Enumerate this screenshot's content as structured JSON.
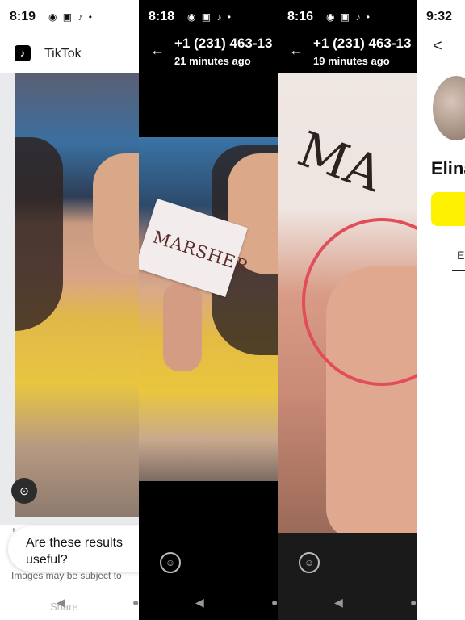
{
  "panel1": {
    "status_time": "8:19",
    "status_icons": "◉ ▣ ♪ •",
    "app_name": "TikTok",
    "app_logo": "♪",
    "lens_icon": "⊙",
    "feedback_question": "Are these results useful?",
    "disclaimer": "Images may be subject to",
    "share_label": "Share",
    "nav_back": "◀",
    "nav_home": "●"
  },
  "panel2": {
    "status_time": "8:18",
    "status_icons": "◉ ▣ ♪ •",
    "contact": "+1 (231) 463-13",
    "subtitle": "21 minutes ago",
    "sign_text": "MARSHER",
    "back_arrow": "←",
    "emoji_icon": "☺",
    "nav_back": "◀",
    "nav_home": "●"
  },
  "panel3": {
    "status_time": "8:16",
    "status_icons": "◉ ▣ ♪ •",
    "contact": "+1 (231) 463-13",
    "subtitle": "19 minutes ago",
    "sign_text": "MA",
    "back_arrow": "←",
    "emoji_icon": "☺",
    "nav_back": "◀",
    "nav_home": "●"
  },
  "panel4": {
    "status_time": "9:32",
    "back": "<",
    "name": "Elina",
    "tab": "E"
  }
}
